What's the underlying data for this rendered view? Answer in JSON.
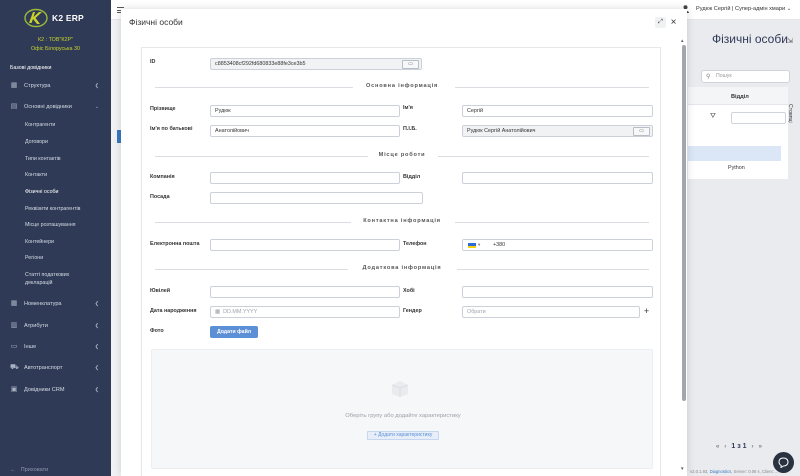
{
  "app": {
    "logo_text": "K2 ERP",
    "company_line1": "К2 : ТОВ\"К2Р\"",
    "company_line2": "Офіс Білоруська 30"
  },
  "sidebar": {
    "section_label": "Базові довідники",
    "items": [
      {
        "label": "Структура",
        "icon": "structure-icon"
      },
      {
        "label": "Основні довідники",
        "icon": "document-icon"
      },
      {
        "label": "Номенклатура",
        "icon": "grid-icon"
      },
      {
        "label": "Атрибути",
        "icon": "attribute-icon"
      },
      {
        "label": "Інше",
        "icon": "folder-icon"
      },
      {
        "label": "Автотранспорт",
        "icon": "car-icon"
      },
      {
        "label": "Довідники CRM",
        "icon": "crm-icon"
      }
    ],
    "subitems": [
      "Контрагенти",
      "Договори",
      "Типи контактів",
      "Контакти",
      "Фізичні особи",
      "Реквізити контрагентів",
      "Місце розташування",
      "Контейнери",
      "Регіони",
      "Статті податкових",
      "декларацій"
    ],
    "bottom_label": "Приховати"
  },
  "header": {
    "user_label": "Рудюк Сергій | Супер-адмін хмари",
    "page_title": "Фізичні особи"
  },
  "background": {
    "search_placeholder": "Пошук",
    "column_header": "Відділ",
    "row_value": "Python",
    "columns_toggle": "Стовпці",
    "pager_text": "1 з 1",
    "footer_prefix": "v2.0.1.93, ",
    "footer_link": "Diagnostics",
    "footer_suffix": ", Server: 0.06 s, Client: ..."
  },
  "modal": {
    "title": "Фізичні особи",
    "id_label": "ID",
    "id_value": "c8853408cf292fd680833e88fe3ce3b5",
    "sections": {
      "main": "Основна інформація",
      "work": "Місце роботи",
      "contact": "Контактна інформація",
      "extra": "Додаткова інформація"
    },
    "fields": {
      "surname_label": "Прізвище",
      "surname_value": "Рудюк",
      "name_label": "Ім'я",
      "name_value": "Сергій",
      "patronymic_label": "Ім'я по батькові",
      "patronymic_value": "Анатолійович",
      "fullname_label": "П.І.Б.",
      "fullname_value": "Рудюк Сергій Анатолійович",
      "company_label": "Компанія",
      "department_label": "Відділ",
      "position_label": "Посада",
      "email_label": "Електронна пошта",
      "phone_label": "Телефон",
      "phone_code": "+380",
      "jubilee_label": "Ювілей",
      "hobby_label": "Хобі",
      "birthdate_label": "Дата народження",
      "birthdate_placeholder": "DD.MM.YYYY",
      "gender_label": "Гендер",
      "gender_placeholder": "Обрати",
      "photo_label": "Фото",
      "add_file": "Додати файл"
    },
    "characteristics": {
      "hint": "Оберіть групу або додайте характеристику",
      "add_button": "+ Додати характеристику"
    }
  },
  "colors": {
    "sidebar_bg": "#2f3a56",
    "company_text": "#c9d32a",
    "accent": "#5b8fd6"
  }
}
